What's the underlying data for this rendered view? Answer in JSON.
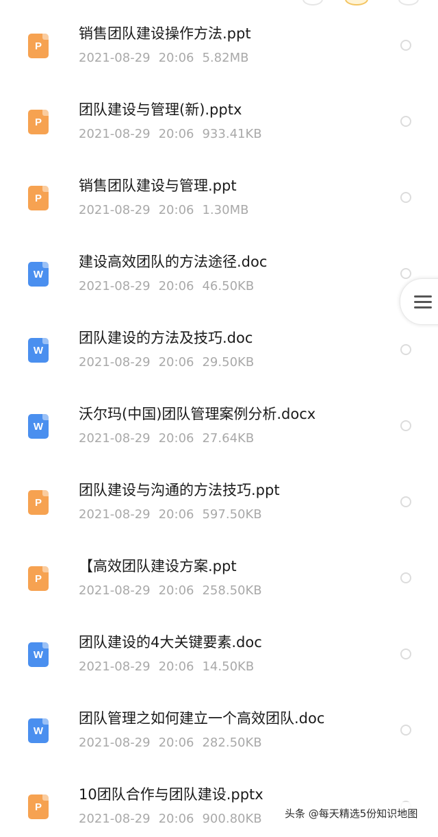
{
  "files": [
    {
      "name": "销售团队建设操作方法.ppt",
      "date": "2021-08-29",
      "time": "20:06",
      "size": "5.82MB",
      "type": "ppt",
      "icon": "P"
    },
    {
      "name": "团队建设与管理(新).pptx",
      "date": "2021-08-29",
      "time": "20:06",
      "size": "933.41KB",
      "type": "ppt",
      "icon": "P"
    },
    {
      "name": "销售团队建设与管理.ppt",
      "date": "2021-08-29",
      "time": "20:06",
      "size": "1.30MB",
      "type": "ppt",
      "icon": "P"
    },
    {
      "name": "建设高效团队的方法途径.doc",
      "date": "2021-08-29",
      "time": "20:06",
      "size": "46.50KB",
      "type": "doc",
      "icon": "W"
    },
    {
      "name": "团队建设的方法及技巧.doc",
      "date": "2021-08-29",
      "time": "20:06",
      "size": "29.50KB",
      "type": "doc",
      "icon": "W"
    },
    {
      "name": "沃尔玛(中国)团队管理案例分析.docx",
      "date": "2021-08-29",
      "time": "20:06",
      "size": "27.64KB",
      "type": "doc",
      "icon": "W"
    },
    {
      "name": "团队建设与沟通的方法技巧.ppt",
      "date": "2021-08-29",
      "time": "20:06",
      "size": "597.50KB",
      "type": "ppt",
      "icon": "P"
    },
    {
      "name": "【高效团队建设方案.ppt",
      "date": "2021-08-29",
      "time": "20:06",
      "size": "258.50KB",
      "type": "ppt",
      "icon": "P"
    },
    {
      "name": "团队建设的4大关键要素.doc",
      "date": "2021-08-29",
      "time": "20:06",
      "size": "14.50KB",
      "type": "doc",
      "icon": "W"
    },
    {
      "name": "团队管理之如何建立一个高效团队.doc",
      "date": "2021-08-29",
      "time": "20:06",
      "size": "282.50KB",
      "type": "doc",
      "icon": "W"
    },
    {
      "name": "10团队合作与团队建设.pptx",
      "date": "2021-08-29",
      "time": "20:06",
      "size": "900.80KB",
      "type": "ppt",
      "icon": "P"
    }
  ],
  "colors": {
    "ppt_icon": "#f6a251",
    "doc_icon": "#4a8fef",
    "name_text": "#1a1a1a",
    "meta_text": "#a9a9a9",
    "radio_border": "#dcdcdc"
  },
  "icons": {
    "ppt": "ppt-file-icon",
    "doc": "word-file-icon",
    "select": "radio-circle-icon",
    "menu": "menu-lines-icon"
  },
  "watermark": {
    "text": "头条 @每天精选5份知识地图"
  }
}
